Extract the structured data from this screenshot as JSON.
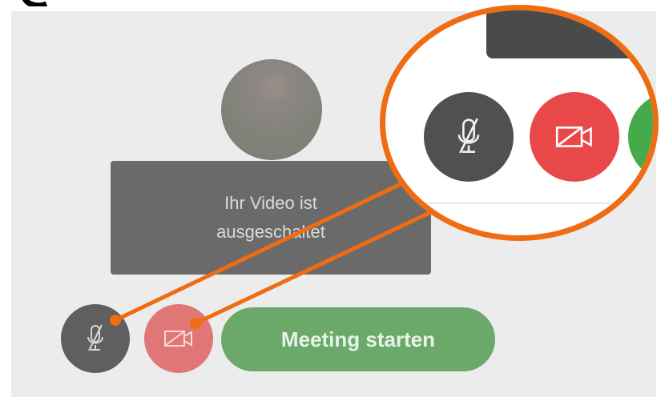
{
  "video_message": {
    "line1": "Ihr Video ist",
    "line2": "ausgeschaltet"
  },
  "controls": {
    "mic_icon": "muted-microphone-icon",
    "camera_icon": "camera-off-icon",
    "start_label": "Meeting starten"
  },
  "colors": {
    "highlight": "#ef6c12",
    "start_button": "#6aa96a",
    "camera_button": "#e94848",
    "mic_button": "#505050"
  }
}
